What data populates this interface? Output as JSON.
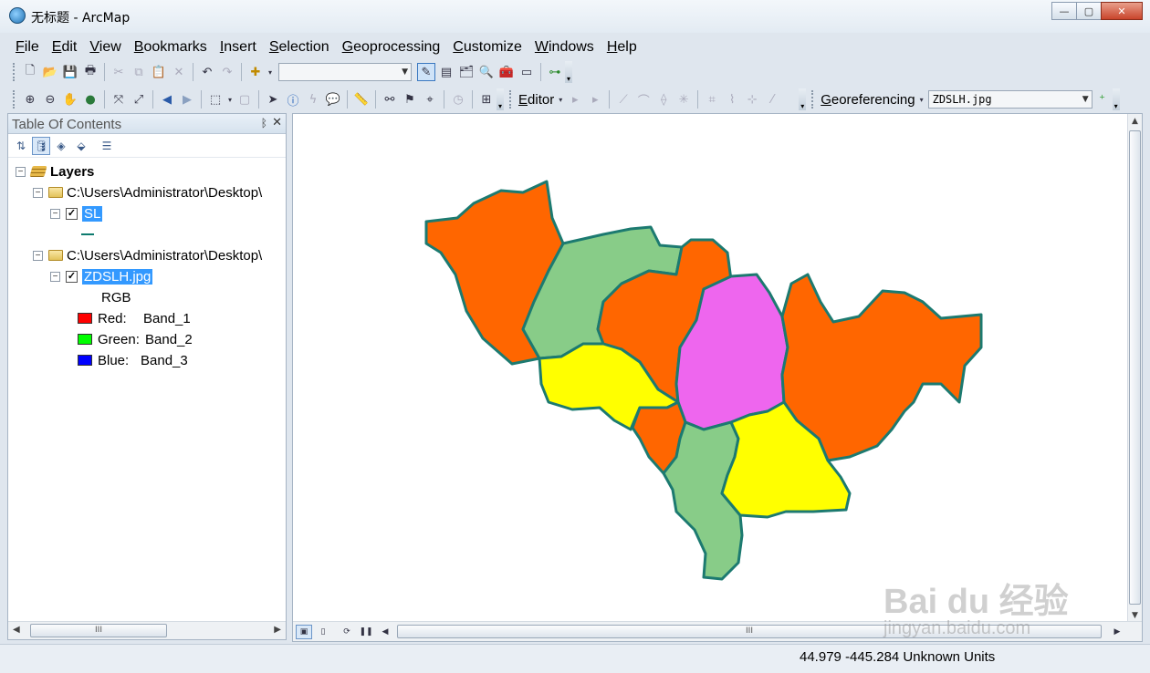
{
  "window": {
    "title": "无标题 - ArcMap",
    "minimize": "—",
    "maximize": "▢",
    "close": "✕"
  },
  "menu": [
    "File",
    "Edit",
    "View",
    "Bookmarks",
    "Insert",
    "Selection",
    "Geoprocessing",
    "Customize",
    "Windows",
    "Help"
  ],
  "toolbar2": {
    "editor_label": "Editor",
    "georef_label": "Georeferencing",
    "georef_layer": "ZDSLH.jpg"
  },
  "toc": {
    "title": "Table Of Contents",
    "pin": "ᛒ",
    "close": "✕",
    "root": "Layers",
    "groups": [
      {
        "path": "C:\\Users\\Administrator\\Desktop\\",
        "layer": "SL"
      },
      {
        "path": "C:\\Users\\Administrator\\Desktop\\",
        "layer": "ZDSLH.jpg",
        "legend_title": "RGB",
        "bands": [
          {
            "label": "Red:",
            "value": "Band_1",
            "color": "#ff0000"
          },
          {
            "label": "Green:",
            "value": "Band_2",
            "color": "#00ff00"
          },
          {
            "label": "Blue:",
            "value": "Band_3",
            "color": "#0000ff"
          }
        ]
      }
    ],
    "scroll_grip": "III"
  },
  "map": {
    "colors": {
      "orange": "#ff6600",
      "green": "#88cc88",
      "yellow": "#ffff00",
      "magenta": "#ee66ee",
      "outline": "#1c7a70"
    },
    "scroll_grip": "III",
    "regions": [
      {
        "name": "northwest-region",
        "fill": "orange"
      },
      {
        "name": "north-central-region",
        "fill": "green"
      },
      {
        "name": "central-north-region",
        "fill": "orange"
      },
      {
        "name": "center-region",
        "fill": "magenta"
      },
      {
        "name": "east-region",
        "fill": "orange"
      },
      {
        "name": "west-yellow-region",
        "fill": "yellow"
      },
      {
        "name": "small-orange-region",
        "fill": "orange"
      },
      {
        "name": "south-green-region",
        "fill": "green"
      },
      {
        "name": "southeast-yellow-region",
        "fill": "yellow"
      }
    ]
  },
  "status": {
    "coordinates": "44.979  -445.284 Unknown Units"
  },
  "watermark": {
    "main": "Bai du 经验",
    "sub": "jingyan.baidu.com"
  }
}
